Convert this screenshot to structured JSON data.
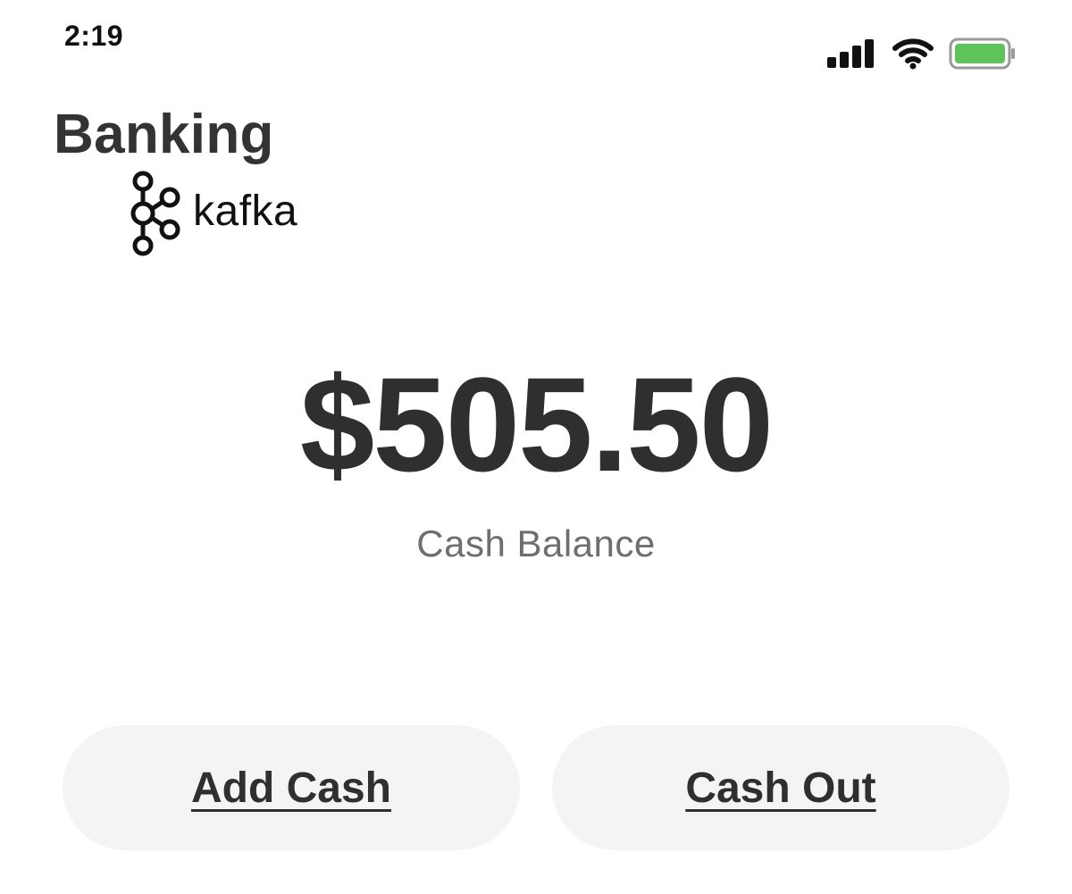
{
  "status_bar": {
    "time": "2:19",
    "icons": [
      "cellular-signal-icon",
      "wifi-icon",
      "battery-icon"
    ],
    "battery_color": "#5ec35a"
  },
  "header": {
    "title": "Banking",
    "logo_text": "kafka",
    "logo_icon": "kafka-icon"
  },
  "balance": {
    "amount": "$505.50",
    "label": "Cash Balance"
  },
  "actions": {
    "add_cash_label": "Add Cash",
    "cash_out_label": "Cash Out"
  },
  "colors": {
    "text_primary": "#2f2f2f",
    "text_secondary": "#6e6e6e",
    "button_bg": "#f4f4f4"
  }
}
